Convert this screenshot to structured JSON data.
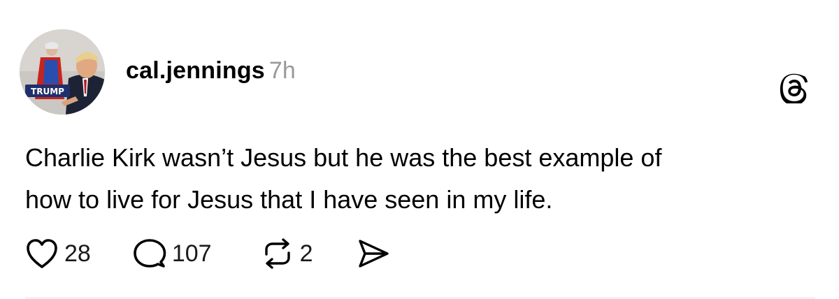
{
  "post": {
    "avatar": {
      "icon": "profile-avatar",
      "badge_text": "TRUMP",
      "badge_color": "#1f2f6b"
    },
    "username": "cal.jennings",
    "timestamp": "7h",
    "app_icon": "threads-logo-icon",
    "text_lines": [
      "Charlie Kirk wasn’t Jesus but he was the best example of",
      "how to live for Jesus that I have seen in my life."
    ],
    "actions": {
      "likes": "28",
      "replies": "107",
      "reposts": "2",
      "like_icon": "heart-icon",
      "reply_icon": "comment-bubble-icon",
      "repost_icon": "repost-arrows-icon",
      "share_icon": "send-icon"
    },
    "colors": {
      "text": "#000000",
      "timestamp": "#999999",
      "divider": "#dddddd"
    }
  }
}
